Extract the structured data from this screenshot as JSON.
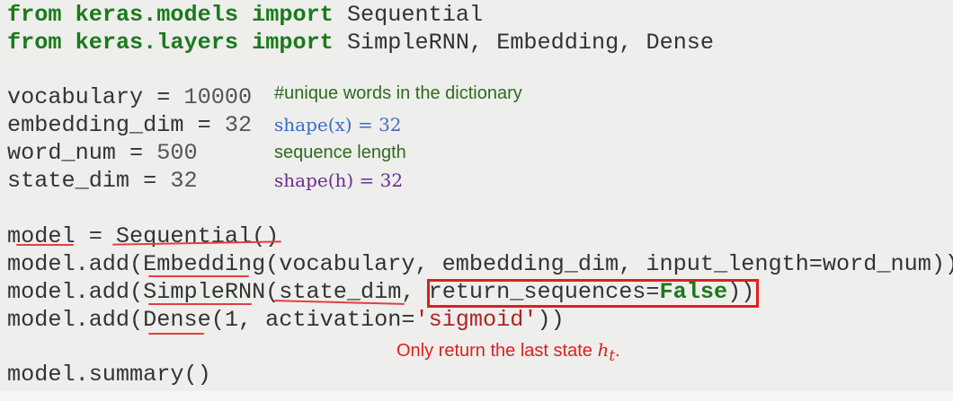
{
  "imports": [
    {
      "kw1": "from",
      "module": "keras.models",
      "kw2": "import",
      "names": "Sequential"
    },
    {
      "kw1": "from",
      "module": "keras.layers",
      "kw2": "import",
      "names": "SimpleRNN, Embedding, Dense"
    }
  ],
  "assignments": [
    {
      "name": "vocabulary",
      "op": " = ",
      "value": "10000",
      "comment": "#unique words in the dictionary"
    },
    {
      "name": "embedding_dim",
      "op": " = ",
      "value": "32",
      "comment": "shape(x) = 32"
    },
    {
      "name": "word_num",
      "op": " = ",
      "value": "500",
      "comment": "sequence length"
    },
    {
      "name": "state_dim",
      "op": " = ",
      "value": "32",
      "comment": "shape(h) = 32"
    }
  ],
  "model_lines": {
    "l1": "model = Sequential()",
    "l2": "model.add(Embedding(vocabulary, embedding_dim, input_length=word_num))",
    "l3a": "model.add(SimpleRNN(state_dim, ",
    "l3b": "return_sequences=",
    "l3kw": "False",
    "l3c": "))",
    "l4a": "model.add(Dense(1, activation=",
    "l4str": "'sigmoid'",
    "l4c": "))",
    "l5": "model.summary()"
  },
  "note": {
    "text": "Only return the last state ",
    "math": "h",
    "sub": "t",
    "end": "."
  },
  "colors": {
    "highlight": "#e01e1e",
    "keyword": "#1a7a1a"
  }
}
